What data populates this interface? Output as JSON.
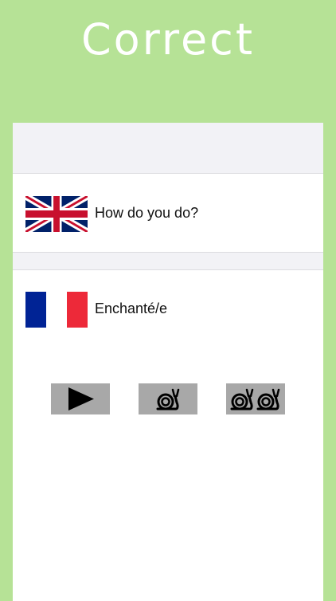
{
  "header": {
    "title": "Correct"
  },
  "phrases": {
    "english": {
      "text": "How do you do?",
      "flag_icon": "uk-flag-icon"
    },
    "french": {
      "text": "Enchanté/e",
      "flag_icon": "france-flag-icon"
    }
  },
  "controls": {
    "play_icon": "play-icon",
    "slow_icon": "snail-icon",
    "slower_icon": "double-snail-icon"
  },
  "colors": {
    "background": "#b6e296",
    "card": "#ffffff",
    "section_gap": "#f2f2f6",
    "button": "#a8a8a8",
    "title": "#ffffff"
  }
}
